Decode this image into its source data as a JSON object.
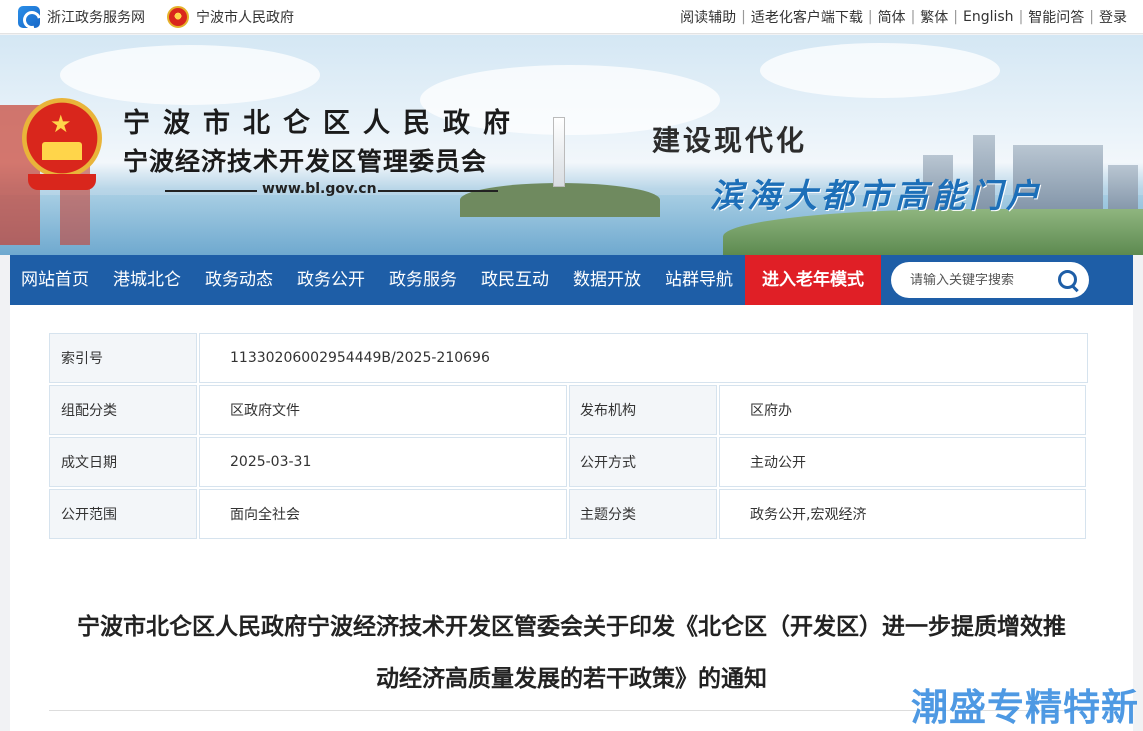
{
  "topbar": {
    "site1": "浙江政务服务网",
    "site2": "宁波市人民政府",
    "links": [
      "阅读辅助",
      "适老化客户端下载",
      "简体",
      "繁体",
      "English",
      "智能问答",
      "登录"
    ]
  },
  "banner": {
    "title_line1": "宁波市北仑区人民政府",
    "title_line2": "宁波经济技术开发区管理委员会",
    "url": "www.bl.gov.cn",
    "slogan1": "建设现代化",
    "slogan2": "滨海大都市高能门户"
  },
  "nav": {
    "items": [
      "网站首页",
      "港城北仑",
      "政务动态",
      "政务公开",
      "政务服务",
      "政民互动",
      "数据开放",
      "站群导航"
    ],
    "elder_mode": "进入老年模式",
    "search_placeholder": "请输入关键字搜索"
  },
  "meta": {
    "index_label": "索引号",
    "index_value": "11330206002954449B/2025-210696",
    "category_label": "组配分类",
    "category_value": "区政府文件",
    "publisher_label": "发布机构",
    "publisher_value": "区府办",
    "date_label": "成文日期",
    "date_value": "2025-03-31",
    "open_method_label": "公开方式",
    "open_method_value": "主动公开",
    "scope_label": "公开范围",
    "scope_value": "面向全社会",
    "topic_label": "主题分类",
    "topic_value": "政务公开,宏观经济"
  },
  "document": {
    "title_line1": "宁波市北仑区人民政府宁波经济技术开发区管委会关于印发《北仑区（开发区）进一步提质增效推",
    "title_line2": "动经济高质量发展的若干政策》的通知"
  },
  "watermark": "潮盛专精特新",
  "colors": {
    "nav_bg": "#1e5ea7",
    "elder_bg": "#e01f26",
    "slogan_blue": "#1d6fb8"
  }
}
